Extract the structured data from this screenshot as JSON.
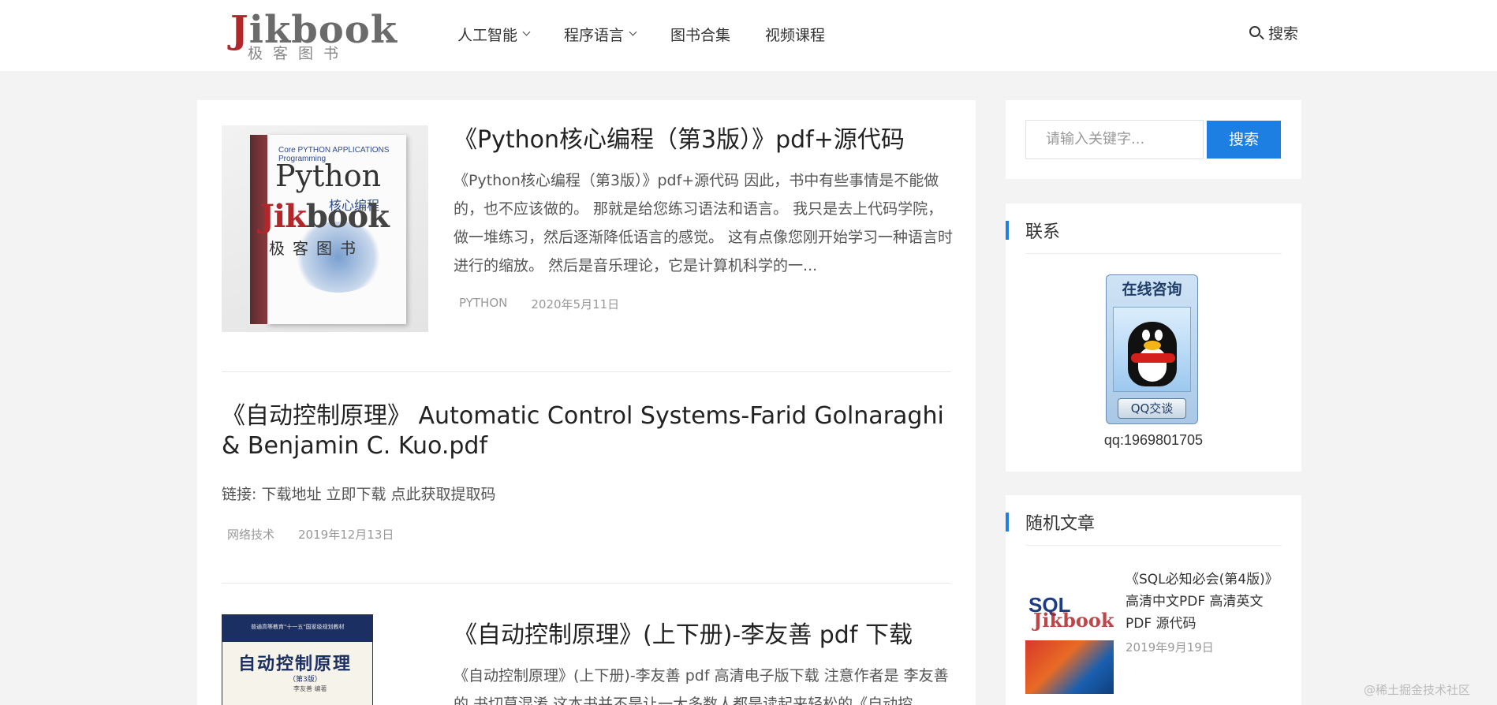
{
  "header": {
    "logo_main_red": "J",
    "logo_main_rest": "ikbook",
    "logo_sub": "极客图书",
    "nav": [
      {
        "label": "人工智能",
        "has_dropdown": true
      },
      {
        "label": "程序语言",
        "has_dropdown": true
      },
      {
        "label": "图书合集",
        "has_dropdown": false
      },
      {
        "label": "视频课程",
        "has_dropdown": false
      }
    ],
    "search_label": "搜索",
    "search_icon": "search-icon"
  },
  "posts": [
    {
      "title": "《Python核心编程（第3版）》pdf+源代码",
      "excerpt": "《Python核心编程（第3版）》pdf+源代码 因此，书中有些事情是不能做的，也不应该做的。 那就是给您练习语法和语言。 我只是去上代码学院，做一堆练习，然后逐渐降低语言的感觉。 这有点像您刚开始学习一种语言时进行的缩放。 然后是音乐理论，它是计算机科学的一...",
      "category": "PYTHON",
      "date": "2020年5月11日",
      "cover": {
        "series": "Core PYTHON APPLICATIONS Programming",
        "title": "Python",
        "subtitle": "核心编程",
        "watermark_red": "Jik",
        "watermark_rest": "book",
        "watermark_sub": "极客图书"
      }
    },
    {
      "title": "《自动控制原理》 Automatic Control Systems-Farid Golnaraghi & Benjamin C. Kuo.pdf",
      "excerpt": "链接: 下载地址 立即下载 点此获取提取码",
      "category": "网络技术",
      "date": "2019年12月13日"
    },
    {
      "title": "《自动控制原理》(上下册)-李友善 pdf 下载",
      "excerpt": "《自动控制原理》(上下册)-李友善 pdf 高清电子版下载 注意作者是 李友善的 书切莫混淆 这本书并不是让一大多数人都是读起来轻松的《自动控",
      "cover": {
        "band": "普通高等教育\"十一五\"国家级规划教材",
        "title": "自动控制原理",
        "edition": "（第3版）",
        "author": "李友善 编著"
      }
    }
  ],
  "sidebar": {
    "search_placeholder": "请输入关键字...",
    "search_button": "搜索",
    "contact_title": "联系",
    "qq_header": "在线咨询",
    "qq_button": "QQ交谈",
    "qq_number": "qq:1969801705",
    "random_title": "随机文章",
    "random_post": {
      "title": "《SQL必知必会(第4版)》高清中文PDF 高清英文PDF 源代码",
      "date": "2019年9月19日",
      "cover_title": "SQL",
      "cover_watermark": "Jikbook"
    }
  },
  "watermark": "@稀土掘金技术社区",
  "colors": {
    "accent": "#1e7fe3",
    "logo_red": "#b3262a",
    "page_bg": "#f3f3f3"
  }
}
